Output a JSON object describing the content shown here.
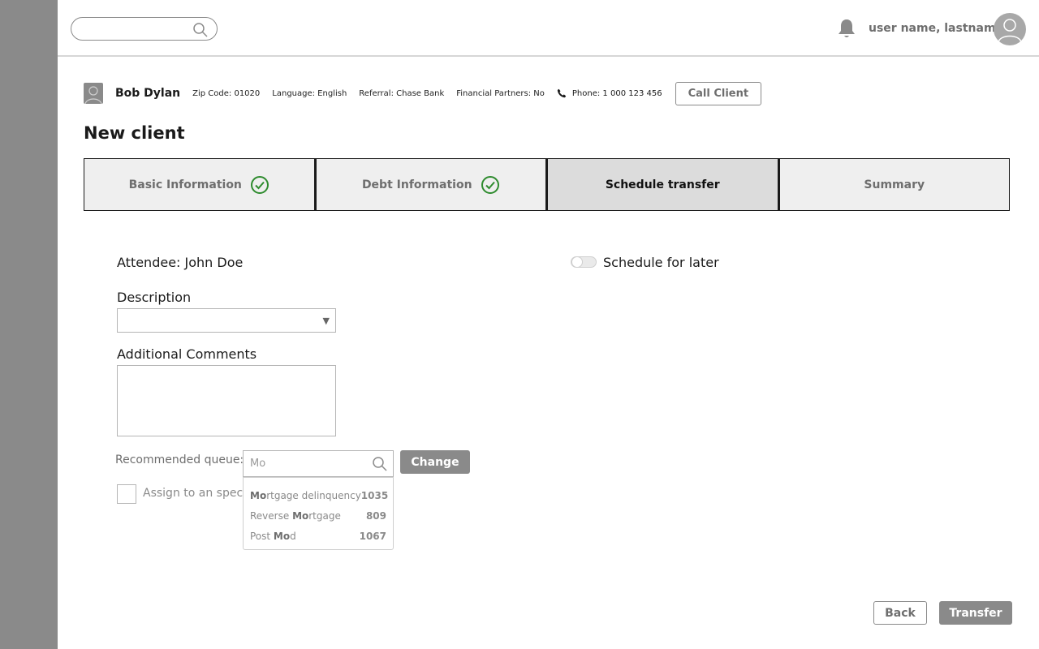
{
  "header": {
    "search": {
      "value": "",
      "placeholder": ""
    },
    "username": "user name, lastname"
  },
  "client": {
    "name": "Bob Dylan",
    "zip": "Zip Code: 01020",
    "language": "Language: English",
    "referral": "Referral: Chase Bank",
    "partners": "Financial Partners: No",
    "phone": "Phone: 1 000 123 456",
    "call_label": "Call Client"
  },
  "page_title": "New client",
  "steps": [
    {
      "label": "Basic Information",
      "status": "complete"
    },
    {
      "label": "Debt Information",
      "status": "complete"
    },
    {
      "label": "Schedule transfer",
      "status": "active"
    },
    {
      "label": "Summary",
      "status": "pending"
    }
  ],
  "form": {
    "attendee": "Attendee: John Doe",
    "schedule_later_label": "Schedule for later",
    "schedule_later_on": false,
    "description_label": "Description",
    "description_value": "",
    "comments_label": "Additional Comments",
    "comments_value": "",
    "queue_label": "Recommended queue:",
    "queue_value": "Mo",
    "change_label": "Change",
    "assign_label": "Assign to an specific agent",
    "assign_checked": false
  },
  "queue_suggestions": [
    {
      "match": "Mo",
      "rest": "rtgage delinquency",
      "prefix": "",
      "count": "1035"
    },
    {
      "prefix": "Reverse ",
      "match": "Mo",
      "rest": "rtgage",
      "count": "809"
    },
    {
      "prefix": "Post ",
      "match": "Mo",
      "rest": "d",
      "count": "1067"
    }
  ],
  "footer": {
    "back_label": "Back",
    "transfer_label": "Transfer"
  },
  "colors": {
    "sidebar": "#8a8a8a",
    "check": "#2e8b2e",
    "active_step": "#dcdcdc"
  }
}
